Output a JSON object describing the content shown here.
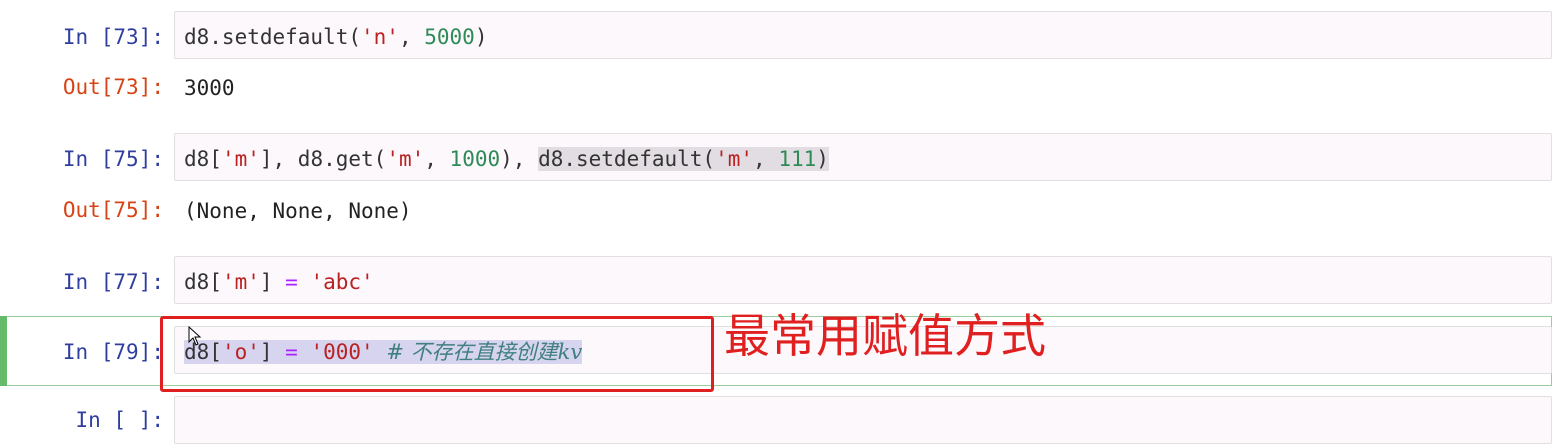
{
  "cells": [
    {
      "in_prompt": "In [73]:",
      "code_parts": [
        "d8.setdefault(",
        "'n'",
        ", ",
        "5000",
        ")"
      ],
      "out_prompt": "Out[73]:",
      "output": "3000"
    },
    {
      "in_prompt": "In [75]:",
      "code_parts": [
        "d8[",
        "'m'",
        "], d8.get(",
        "'m'",
        ", ",
        "1000",
        "), ",
        "d8.setdefault(",
        "'m'",
        ", ",
        "111",
        ")"
      ],
      "out_prompt": "Out[75]:",
      "output": "(None, None, None)"
    },
    {
      "in_prompt": "In [77]:",
      "code_parts": [
        "d8[",
        "'m'",
        "] ",
        "=",
        " ",
        "'abc'"
      ]
    },
    {
      "in_prompt": "In [79]:",
      "code_parts": [
        "d8[",
        "'o'",
        "] ",
        "=",
        " ",
        "'000'",
        " ",
        "# 不存在直接创建kv"
      ]
    },
    {
      "in_prompt": "In [ ]:"
    }
  ],
  "annotation": {
    "text": "最常用赋值方式",
    "color": "#e02020"
  },
  "colors": {
    "in_prompt": "#303f9f",
    "out_prompt": "#d84315",
    "string": "#ba2121",
    "number": "#2e8b57",
    "operator": "#aa22ff",
    "comment": "#408080",
    "selected_bar": "#66bb6a"
  }
}
